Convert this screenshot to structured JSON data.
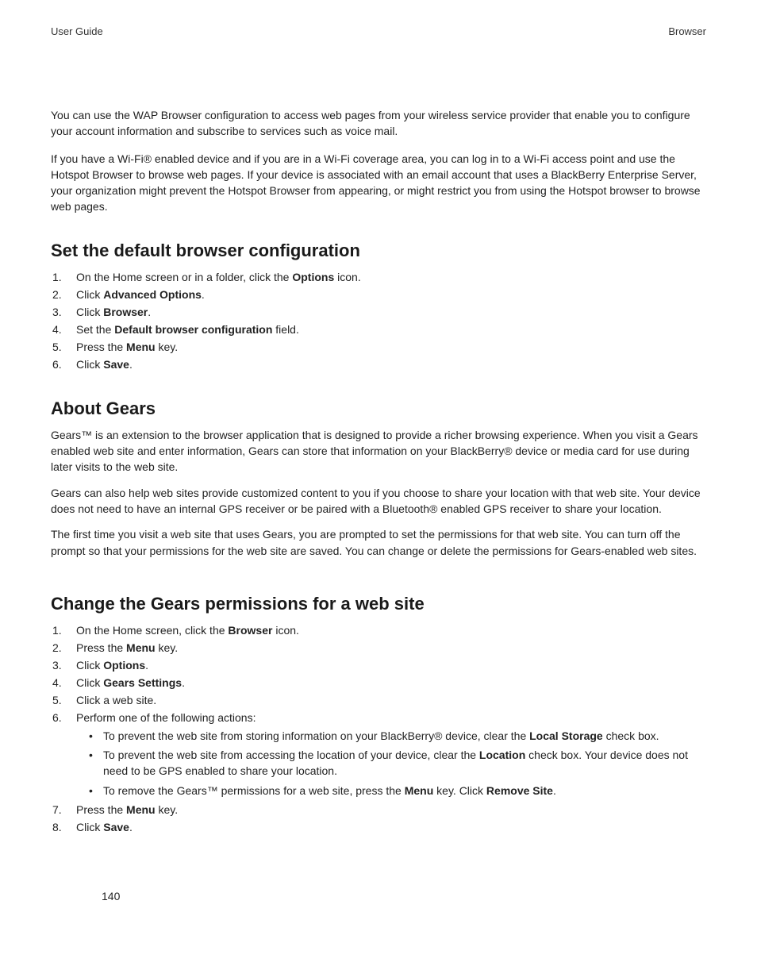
{
  "header": {
    "left": "User Guide",
    "right": "Browser"
  },
  "intro": {
    "p1": "You can use the WAP Browser configuration to access web pages from your wireless service provider that enable you to configure your account information and subscribe to services such as voice mail.",
    "p2": "If you have a Wi-Fi® enabled device and if you are in a Wi-Fi coverage area, you can log in to a Wi-Fi access point and use the Hotspot Browser to browse web pages. If your device is associated with an email account that uses a BlackBerry Enterprise Server, your organization might prevent the Hotspot Browser from appearing, or might restrict you from using the Hotspot browser to browse web pages."
  },
  "sec1": {
    "title": "Set the default browser configuration",
    "s1a": "On the Home screen or in a folder, click the ",
    "s1b": "Options",
    "s1c": " icon.",
    "s2a": "Click ",
    "s2b": "Advanced Options",
    "s2c": ".",
    "s3a": "Click ",
    "s3b": "Browser",
    "s3c": ".",
    "s4a": "Set the ",
    "s4b": "Default browser configuration",
    "s4c": " field.",
    "s5a": "Press the ",
    "s5b": "Menu",
    "s5c": " key.",
    "s6a": "Click ",
    "s6b": "Save",
    "s6c": "."
  },
  "sec2": {
    "title": "About Gears",
    "p1": "Gears™ is an extension to the browser application that is designed to provide a richer browsing experience. When you visit a Gears enabled web site and enter information, Gears can store that information on your BlackBerry® device or media card for use during later visits to the web site.",
    "p2": "Gears can also help web sites provide customized content to you if you choose to share your location with that web site. Your device does not need to have an internal GPS receiver or be paired with a Bluetooth® enabled GPS receiver to share your location.",
    "p3": "The first time you visit a web site that uses Gears, you are prompted to set the permissions for that web site. You can turn off the prompt so that your permissions for the web site are saved. You can change or delete the permissions for Gears-enabled web sites."
  },
  "sec3": {
    "title": "Change the Gears permissions for a web site",
    "s1a": "On the Home screen, click the ",
    "s1b": "Browser",
    "s1c": " icon.",
    "s2a": "Press the ",
    "s2b": "Menu",
    "s2c": " key.",
    "s3a": "Click ",
    "s3b": "Options",
    "s3c": ".",
    "s4a": "Click ",
    "s4b": "Gears Settings",
    "s4c": ".",
    "s5": "Click a web site.",
    "s6": "Perform one of the following actions:",
    "b1a": "To prevent the web site from storing information on your BlackBerry® device, clear the ",
    "b1b": "Local Storage",
    "b1c": " check box.",
    "b2a": "To prevent the web site from accessing the location of your device, clear the ",
    "b2b": "Location",
    "b2c": " check box. Your device does not need to be GPS enabled to share your location.",
    "b3a": "To remove the Gears™ permissions for a web site, press the ",
    "b3b": "Menu",
    "b3c": " key. Click ",
    "b3d": "Remove Site",
    "b3e": ".",
    "s7a": "Press the ",
    "s7b": "Menu",
    "s7c": " key.",
    "s8a": "Click ",
    "s8b": "Save",
    "s8c": "."
  },
  "page": "140"
}
